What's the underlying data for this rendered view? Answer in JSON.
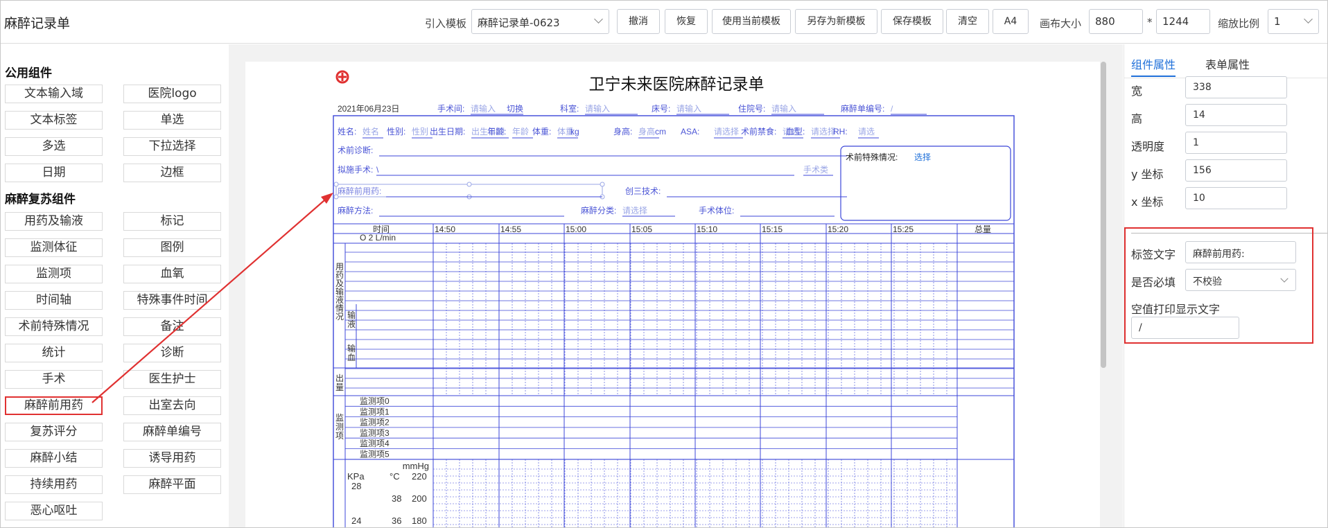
{
  "app": {
    "title": "麻醉记录单"
  },
  "toolbar": {
    "import_label": "引入模板",
    "template_value": "麻醉记录单-0623",
    "buttons": [
      "撤消",
      "恢复",
      "使用当前模板",
      "另存为新模板",
      "保存模板",
      "清空",
      "A4"
    ],
    "canvas_size_label": "画布大小",
    "width_value": "880",
    "times_sign": "*",
    "height_value": "1244",
    "zoom_label": "缩放比例",
    "zoom_value": "1"
  },
  "left_panel": {
    "section_common": "公用组件",
    "common_items": [
      "文本输入域",
      "医院logo",
      "文本标签",
      "单选",
      "多选",
      "下拉选择",
      "日期",
      "边框"
    ],
    "section_anesthesia": "麻醉复苏组件",
    "anesthesia_items": [
      "用药及输液",
      "标记",
      "监测体征",
      "图例",
      "监测项",
      "血氧",
      "时间轴",
      "特殊事件时间",
      "术前特殊情况",
      "备注",
      "统计",
      "诊断",
      "手术",
      "医生护士",
      "麻醉前用药",
      "出室去向",
      "复苏评分",
      "麻醉单编号",
      "麻醉小结",
      "诱导用药",
      "持续用药",
      "麻醉平面",
      "恶心呕吐"
    ],
    "highlighted": "麻醉前用药"
  },
  "document": {
    "title": "卫宁未来医院麻醉记录单",
    "date": "2021年06月23日",
    "row1": [
      {
        "label": "手术间:",
        "value": "请输入"
      },
      {
        "label": "",
        "value": "切换"
      },
      {
        "label": "科室:",
        "value": "请输入"
      },
      {
        "label": "床号:",
        "value": "请输入"
      },
      {
        "label": "住院号:",
        "value": "请输入"
      },
      {
        "label": "麻醉单编号:",
        "value": "/"
      }
    ],
    "row2": [
      {
        "label": "姓名:",
        "value": "姓名"
      },
      {
        "label": "性别:",
        "value": "性别"
      },
      {
        "label": "出生日期:",
        "value": "出生日期"
      },
      {
        "label": "年龄:",
        "value": "年龄"
      },
      {
        "label": "体重:",
        "value": "体重"
      },
      {
        "label": "",
        "value": "kg"
      },
      {
        "label": "身高:",
        "value": "身高"
      },
      {
        "label": "",
        "value": "cm"
      },
      {
        "label": "ASA:",
        "value": "请选择"
      },
      {
        "label": "术前禁食:",
        "value": "请选"
      },
      {
        "label": "血型:",
        "value": "请选择"
      },
      {
        "label": "RH:",
        "value": "请选"
      }
    ],
    "diagnosis_label": "术前诊断:",
    "planned_surgery_label": "拟施手术:",
    "planned_surgery_value": "\\",
    "surgery_class": "手术类",
    "premed_label": "麻醉前用药:",
    "invasive_label": "创三技术:",
    "method_label": "麻醉方法:",
    "category_label": "麻醉分类:",
    "category_value": "请选择",
    "position_label": "手术体位:",
    "special_label": "术前特殊情况:",
    "special_value": "选择",
    "time_header": "时间",
    "o2_label": "O 2 L/min",
    "times": [
      "14:50",
      "14:55",
      "15:00",
      "15:05",
      "15:10",
      "15:15",
      "15:20",
      "15:25"
    ],
    "total_label": "总量",
    "drugs_section": "用药及输液情况",
    "infusion_label": "输液",
    "blood_label": "输血",
    "output_label": "出量",
    "monitor_section": "监测项",
    "monitor_items": [
      "监测项0",
      "监测项1",
      "监测项2",
      "监测项3",
      "监测项4",
      "监测项5"
    ],
    "units": {
      "kpa": "KPa",
      "celsius": "°C",
      "mmhg": "mmHg"
    },
    "scale_rows": [
      [
        "28",
        "",
        "220"
      ],
      [
        "",
        "38",
        "200"
      ],
      [
        "24",
        "36",
        "180"
      ]
    ]
  },
  "right_panel": {
    "tabs": [
      "组件属性",
      "表单属性"
    ],
    "props": [
      {
        "label": "宽",
        "value": "338"
      },
      {
        "label": "高",
        "value": "14"
      },
      {
        "label": "透明度",
        "value": "1"
      },
      {
        "label": "y 坐标",
        "value": "156"
      },
      {
        "label": "x 坐标",
        "value": "10"
      }
    ],
    "label_text_label": "标签文字",
    "label_text_value": "麻醉前用药:",
    "required_label": "是否必填",
    "required_value": "不校验",
    "empty_print_label": "空值打印显示文字",
    "empty_print_value": "/"
  },
  "colors": {
    "accent": "#1e6fd9",
    "grid": "#3b46d8",
    "annotation": "#e03131",
    "placeholder": "#9aa6e6"
  }
}
